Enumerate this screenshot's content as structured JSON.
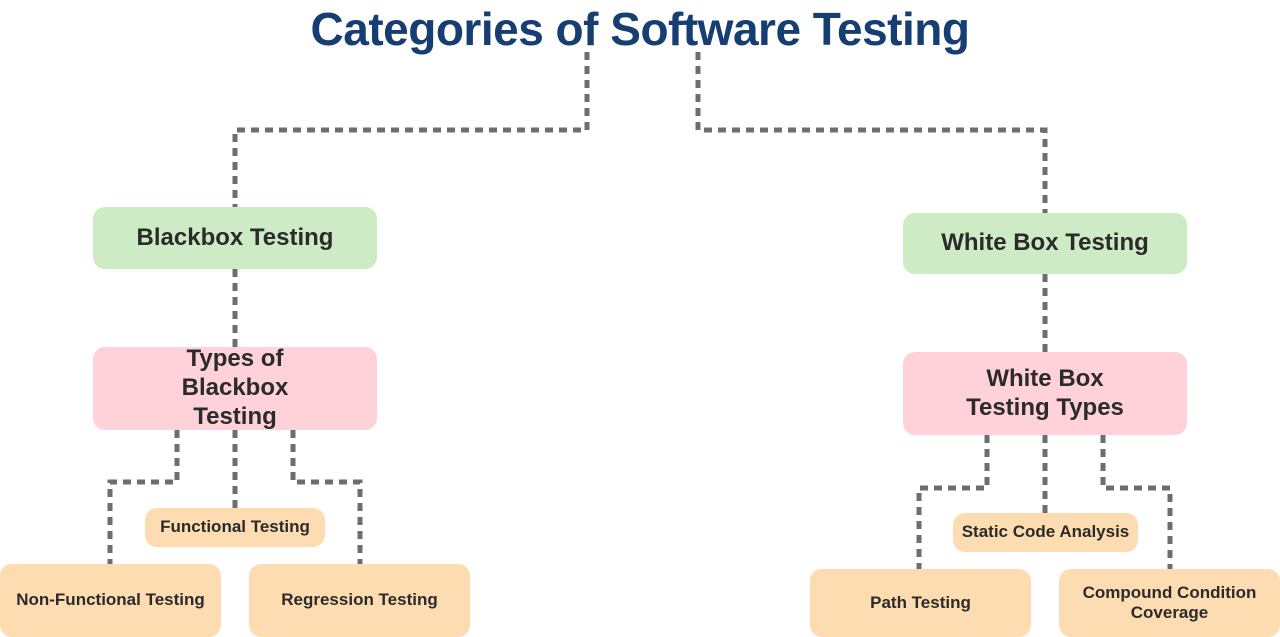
{
  "title": "Categories of Software Testing",
  "colors": {
    "title": "#173e72",
    "category_node": "#cdebc5",
    "types_node": "#ffd1d8",
    "leaf_node": "#fddcb1",
    "connector": "#6e6e6e"
  },
  "left_branch": {
    "category": "Blackbox Testing",
    "types": "Types of Blackbox Testing",
    "leaves": [
      "Functional Testing",
      "Non-Functional Testing",
      "Regression Testing"
    ]
  },
  "right_branch": {
    "category": "White Box Testing",
    "types": "White Box Testing Types",
    "leaves": [
      "Static Code Analysis",
      "Path Testing",
      "Compound Condition Coverage"
    ]
  }
}
